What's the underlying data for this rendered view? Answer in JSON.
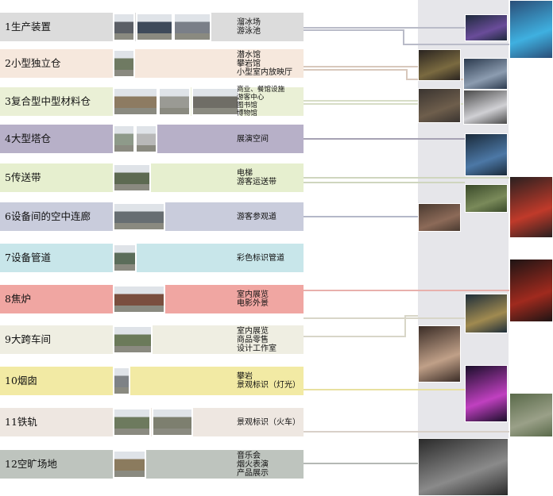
{
  "rows": [
    {
      "label": "1生产装置",
      "uses": [
        "溜冰场",
        "游泳池"
      ],
      "color": "#dcdcdc"
    },
    {
      "label": "2小型独立仓",
      "uses": [
        "潜水馆",
        "攀岩馆",
        "小型室内放映厅"
      ],
      "color": "#f6e8dd"
    },
    {
      "label": "3复合型中型材料仓",
      "uses": [
        "商业、餐馆设施",
        "游客中心",
        "图书馆",
        "博物馆"
      ],
      "color": "#eaf0d6"
    },
    {
      "label": "4大型塔仓",
      "uses": [
        "展演空间"
      ],
      "color": "#b7b0c8"
    },
    {
      "label": "5传送带",
      "uses": [
        "电梯",
        "游客运送带"
      ],
      "color": "#e6efcf"
    },
    {
      "label": "6设备间的空中连廊",
      "uses": [
        "游客参观道"
      ],
      "color": "#c9ccdc"
    },
    {
      "label": "7设备管道",
      "uses": [
        "彩色标识管道"
      ],
      "color": "#c8e6ea"
    },
    {
      "label": "8焦炉",
      "uses": [
        "室内展览",
        "电影外景"
      ],
      "color": "#f0a6a2"
    },
    {
      "label": "9大跨车间",
      "uses": [
        "室内展览",
        "商品零售",
        "设计工作室"
      ],
      "color": "#efeee2"
    },
    {
      "label": "10烟囱",
      "uses": [
        "攀岩",
        "景观标识（灯光）"
      ],
      "color": "#f2eaa4"
    },
    {
      "label": "11铁轨",
      "uses": [
        "景观标识（火车）"
      ],
      "color": "#eee7e1"
    },
    {
      "label": "12空旷场地",
      "uses": [
        "音乐会",
        "烟火表演",
        "产品展示"
      ],
      "color": "#bec4be"
    }
  ]
}
